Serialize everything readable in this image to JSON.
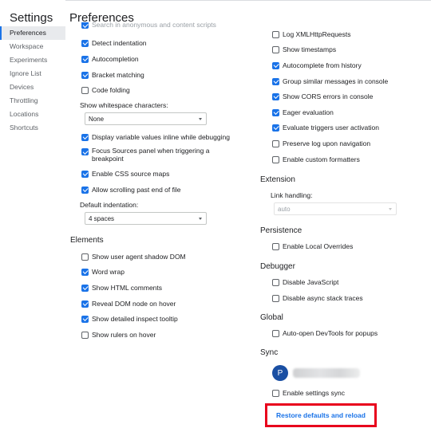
{
  "sidebar": {
    "title": "Settings",
    "items": [
      {
        "label": "Preferences",
        "active": true
      },
      {
        "label": "Workspace"
      },
      {
        "label": "Experiments"
      },
      {
        "label": "Ignore List"
      },
      {
        "label": "Devices"
      },
      {
        "label": "Throttling"
      },
      {
        "label": "Locations"
      },
      {
        "label": "Shortcuts"
      }
    ]
  },
  "main": {
    "title": "Preferences",
    "sources": {
      "cut_row": "Search in anonymous and content scripts",
      "detect_indentation": "Detect indentation",
      "autocompletion": "Autocompletion",
      "bracket_matching": "Bracket matching",
      "code_folding": "Code folding",
      "whitespace_label": "Show whitespace characters:",
      "whitespace_value": "None",
      "inline_values": "Display variable values inline while debugging",
      "focus_sources": "Focus Sources panel when triggering a breakpoint",
      "css_source_maps": "Enable CSS source maps",
      "scroll_past_end": "Allow scrolling past end of file",
      "indent_label": "Default indentation:",
      "indent_value": "4 spaces"
    },
    "elements": {
      "title": "Elements",
      "shadow_dom": "Show user agent shadow DOM",
      "word_wrap": "Word wrap",
      "html_comments": "Show HTML comments",
      "reveal_dom": "Reveal DOM node on hover",
      "inspect_tooltip": "Show detailed inspect tooltip",
      "rulers": "Show rulers on hover"
    },
    "console": {
      "xmlhttp": "Log XMLHttpRequests",
      "timestamps": "Show timestamps",
      "autocomplete_history": "Autocomplete from history",
      "group_similar": "Group similar messages in console",
      "cors_errors": "Show CORS errors in console",
      "eager_eval": "Eager evaluation",
      "user_activation": "Evaluate triggers user activation",
      "preserve_log": "Preserve log upon navigation",
      "custom_formatters": "Enable custom formatters"
    },
    "extension": {
      "title": "Extension",
      "link_handling_label": "Link handling:",
      "link_handling_value": "auto"
    },
    "persistence": {
      "title": "Persistence",
      "local_overrides": "Enable Local Overrides"
    },
    "debugger": {
      "title": "Debugger",
      "disable_js": "Disable JavaScript",
      "disable_async": "Disable async stack traces"
    },
    "global": {
      "title": "Global",
      "auto_open": "Auto-open DevTools for popups"
    },
    "sync": {
      "title": "Sync",
      "avatar_initial": "P",
      "enable_sync": "Enable settings sync"
    },
    "restore_button": "Restore defaults and reload"
  },
  "colors": {
    "accent": "#1a73e8",
    "highlight": "#e8001c",
    "avatar": "#1a4fa3"
  }
}
